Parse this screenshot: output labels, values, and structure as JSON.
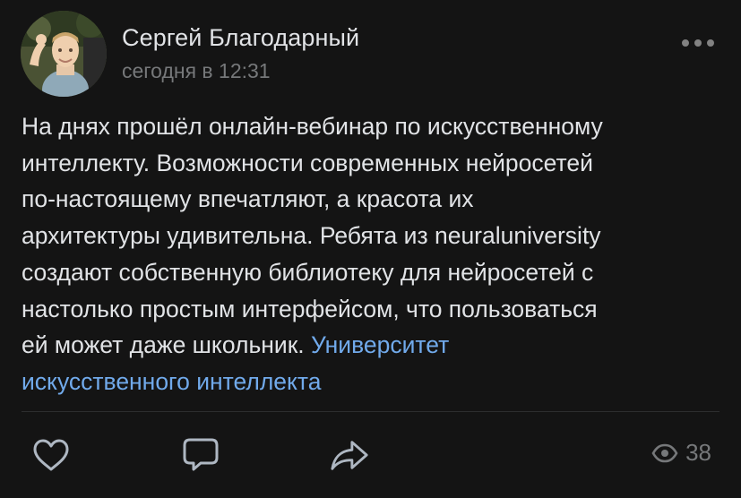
{
  "post": {
    "author": "Сергей Благодарный",
    "time": "сегодня в 12:31",
    "text_lines": [
      "На днях прошёл онлайн-вебинар по искусственному",
      "интеллекту. Возможности современных нейросетей",
      "по-настоящему впечатляют, а красота их",
      "архитектуры удивительна. Ребята из neuraluniversity",
      "создают собственную библиотеку для нейросетей с",
      "настолько простым интерфейсом, что пользоваться",
      "ей может даже школьник."
    ],
    "link_part1": "Университет",
    "link_part2": "искусственного интеллекта"
  },
  "footer": {
    "views_count": "38"
  },
  "icons": {
    "more": "ellipsis-icon",
    "like": "heart-icon",
    "comment": "comment-icon",
    "share": "share-icon",
    "views": "eye-icon"
  },
  "colors": {
    "background": "#141414",
    "text": "#e1e3e6",
    "secondary": "#76787a",
    "link": "#71aaeb"
  }
}
